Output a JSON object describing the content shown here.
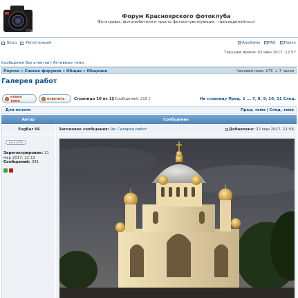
{
  "header": {
    "title": "Форум Красноярского фотоклуба",
    "description": "Фотографы, фотолюбители и просто фотосочувствующие - присоединяйтесь!"
  },
  "nav": {
    "login": "Вход",
    "register": "Регистрация",
    "albums": "Альбомы",
    "faq": "FAQ",
    "search": "Поиск"
  },
  "time": "Текущее время: 03 июн 2017, 12:57",
  "quick_links": {
    "unanswered": "Сообщения без ответов",
    "active": "Активные темы"
  },
  "breadcrumb": {
    "portal": "Портал",
    "forum_list": "Список форумов",
    "general": "Общие",
    "talk": "Общение",
    "timezone": "Часовой пояс: UTC + 7 часов"
  },
  "topic_title": "Галерея работ",
  "buttons": {
    "new_topic": "новая тема",
    "reply": "ответить"
  },
  "pagination": {
    "page_of": "Страница 10 из 11",
    "messages": "[ Сообщений: 215 ]",
    "goto_label": "На страницу",
    "prev": "Пред.",
    "pages": "1 ... 7, 8, 9, 10, 11",
    "next": "След."
  },
  "print_bar": {
    "print": "Для печати",
    "prev_topic": "Пред. тема",
    "next_topic": "След. тема"
  },
  "table": {
    "author_header": "Автор",
    "message_header": "Сообщение"
  },
  "post": {
    "author": "EvgBar 66",
    "inbox_button": "не в сети",
    "registered_label": "Зарегистрирован:",
    "registered_value": "11 мар 2017, 22:12",
    "messages_label": "Сообщений:",
    "messages_value": "391",
    "subject_label": "Заголовок сообщения:",
    "subject_value": "Re: Галерея работ",
    "posted_label": "Добавлено:",
    "posted_value": "22 мар 2017, 11:56"
  },
  "icons": {
    "logo": "camera-logo",
    "login": "login-icon",
    "register": "register-icon",
    "albums": "albums-icon",
    "faq": "faq-icon",
    "search": "search-icon"
  }
}
